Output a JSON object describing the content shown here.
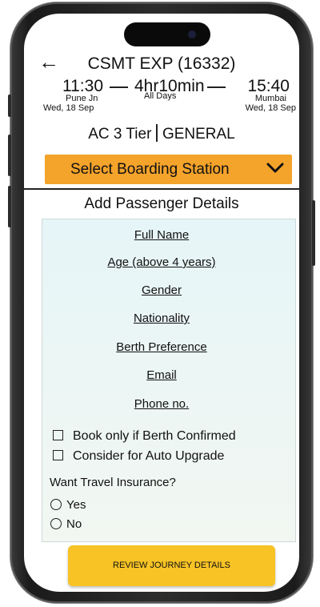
{
  "train": {
    "title": "CSMT EXP (16332)",
    "departure_time": "11:30",
    "arrival_time": "15:40",
    "duration": "4hr10min",
    "runs": "All Days",
    "from_station": "Pune Jn",
    "to_station": "Mumbai",
    "departure_date": "Wed, 18 Sep",
    "arrival_date": "Wed, 18 Sep"
  },
  "class_info": {
    "travel_class": "AC 3 Tier",
    "quota": "GENERAL"
  },
  "boarding": {
    "label": "Select Boarding Station",
    "accent_color": "#f4a32b"
  },
  "passenger_form": {
    "title": "Add Passenger Details",
    "fields": [
      "Full Name",
      "Age (above 4 years)",
      "Gender",
      "Nationality",
      "Berth Preference",
      "Email",
      "Phone no."
    ],
    "checkboxes": [
      {
        "label": "Book only if Berth Confirmed",
        "checked": false
      },
      {
        "label": "Consider for Auto Upgrade",
        "checked": false
      }
    ],
    "insurance_question": "Want Travel Insurance?",
    "insurance_options": [
      {
        "label": "Yes",
        "selected": false
      },
      {
        "label": "No",
        "selected": false
      }
    ]
  },
  "review_button": {
    "label": "REVIEW JOURNEY DETAILS",
    "color": "#f7c325"
  },
  "icons": {
    "back": "back-arrow-icon",
    "dropdown": "chevron-down-icon"
  }
}
